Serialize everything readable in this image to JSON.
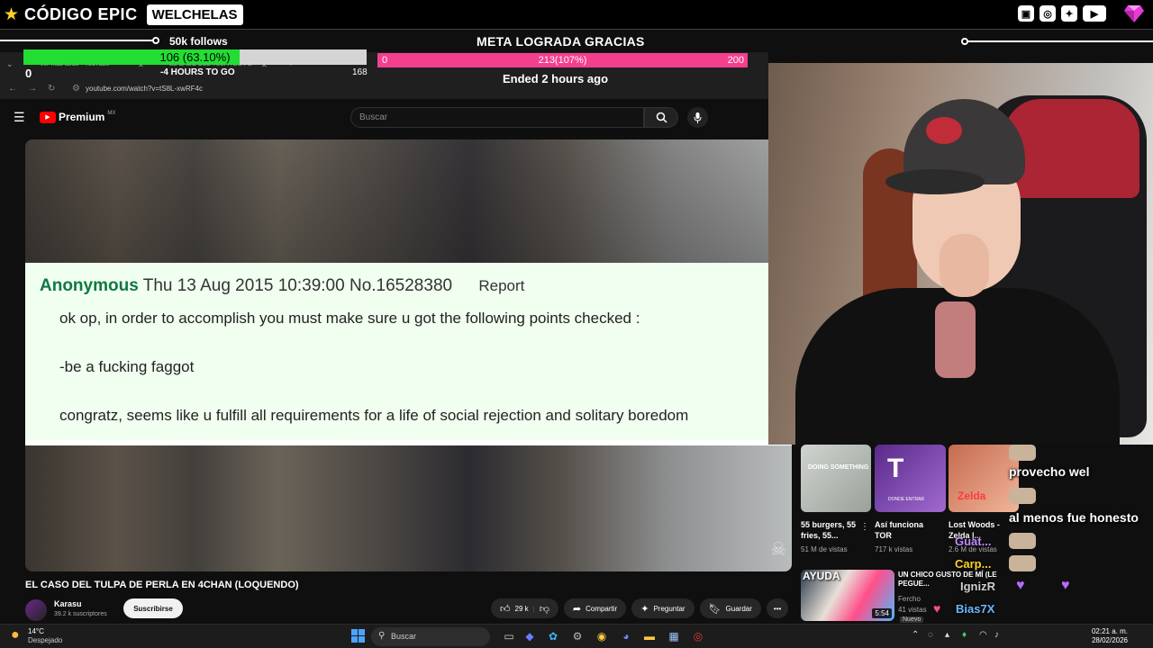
{
  "overlay": {
    "brand_code": "CÓDIGO EPIC",
    "brand_name": "WELCHELAS",
    "colors": {
      "accent_green": "#22dd33",
      "accent_pink": "#f43f8e"
    }
  },
  "follow_goal": {
    "title": "50k follows",
    "progress_text": "106 (63.10%)",
    "progress_fraction": 0.631,
    "start": "0",
    "end": "168",
    "subtext": "-4 HOURS TO GO"
  },
  "sub_goal": {
    "title": "META LOGRADA GRACIAS",
    "start": "0",
    "progress_text": "213(107%)",
    "end": "200",
    "status": "Ended 2 hours ago"
  },
  "browser": {
    "tab1": "Ver más tarde - YouTube",
    "tab2": "EL CASO DEL TULPA DE PE",
    "url": "youtube.com/watch?v=tS8L-xwRF4c"
  },
  "youtube": {
    "logo_word": "Premium",
    "logo_region": "MX",
    "search_placeholder": "Buscar",
    "video_title": "EL CASO DEL TULPA DE PERLA EN 4CHAN (LOQUENDO)",
    "channel_name": "Karasu",
    "channel_subs": "39.2 k suscriptores",
    "subscribe_label": "Suscribirse",
    "like_count": "29 k",
    "share_label": "Compartir",
    "ask_label": "Preguntar",
    "save_label": "Guardar"
  },
  "post": {
    "author": "Anonymous",
    "meta": "Thu 13 Aug 2015 10:39:00 No.16528380",
    "report": "Report",
    "line1": "ok op, in order to accomplish you must make sure u got the following points checked :",
    "line2": "-be a fucking faggot",
    "line3": "congratz, seems like u fulfill all requirements for a life of social rejection and solitary boredom"
  },
  "recommendations": [
    {
      "thumb_text": "DOING SOMETHING",
      "title": "55 burgers, 55 fries, 55...",
      "views": "51 M de vistas"
    },
    {
      "thumb_text": "DONDE ENTRAR",
      "title": "Así funciona TOR",
      "views": "717 k vistas"
    },
    {
      "thumb_text": "Zelda",
      "title": "Lost Woods - Zelda |...",
      "views": "2.6 M de vistas"
    }
  ],
  "recommendation_row2": {
    "thumb_text": "AYUDA",
    "title": "UN CHICO GUSTO DE MÍ (LE PEGUE...",
    "channel": "Fercho",
    "views": "41 vistas",
    "badge": "Nuevo",
    "duration": "5:54"
  },
  "chat": {
    "line1": "provecho wel",
    "line2": "al menos fue honesto",
    "name1": "Guat...",
    "name2": "Carp...",
    "name3": "IgnizR",
    "name4": "Bias7X"
  },
  "taskbar": {
    "temp": "14°C",
    "weather": "Despejado",
    "search": "Buscar",
    "time": "02:21 a. m.",
    "date": "28/02/2026"
  }
}
